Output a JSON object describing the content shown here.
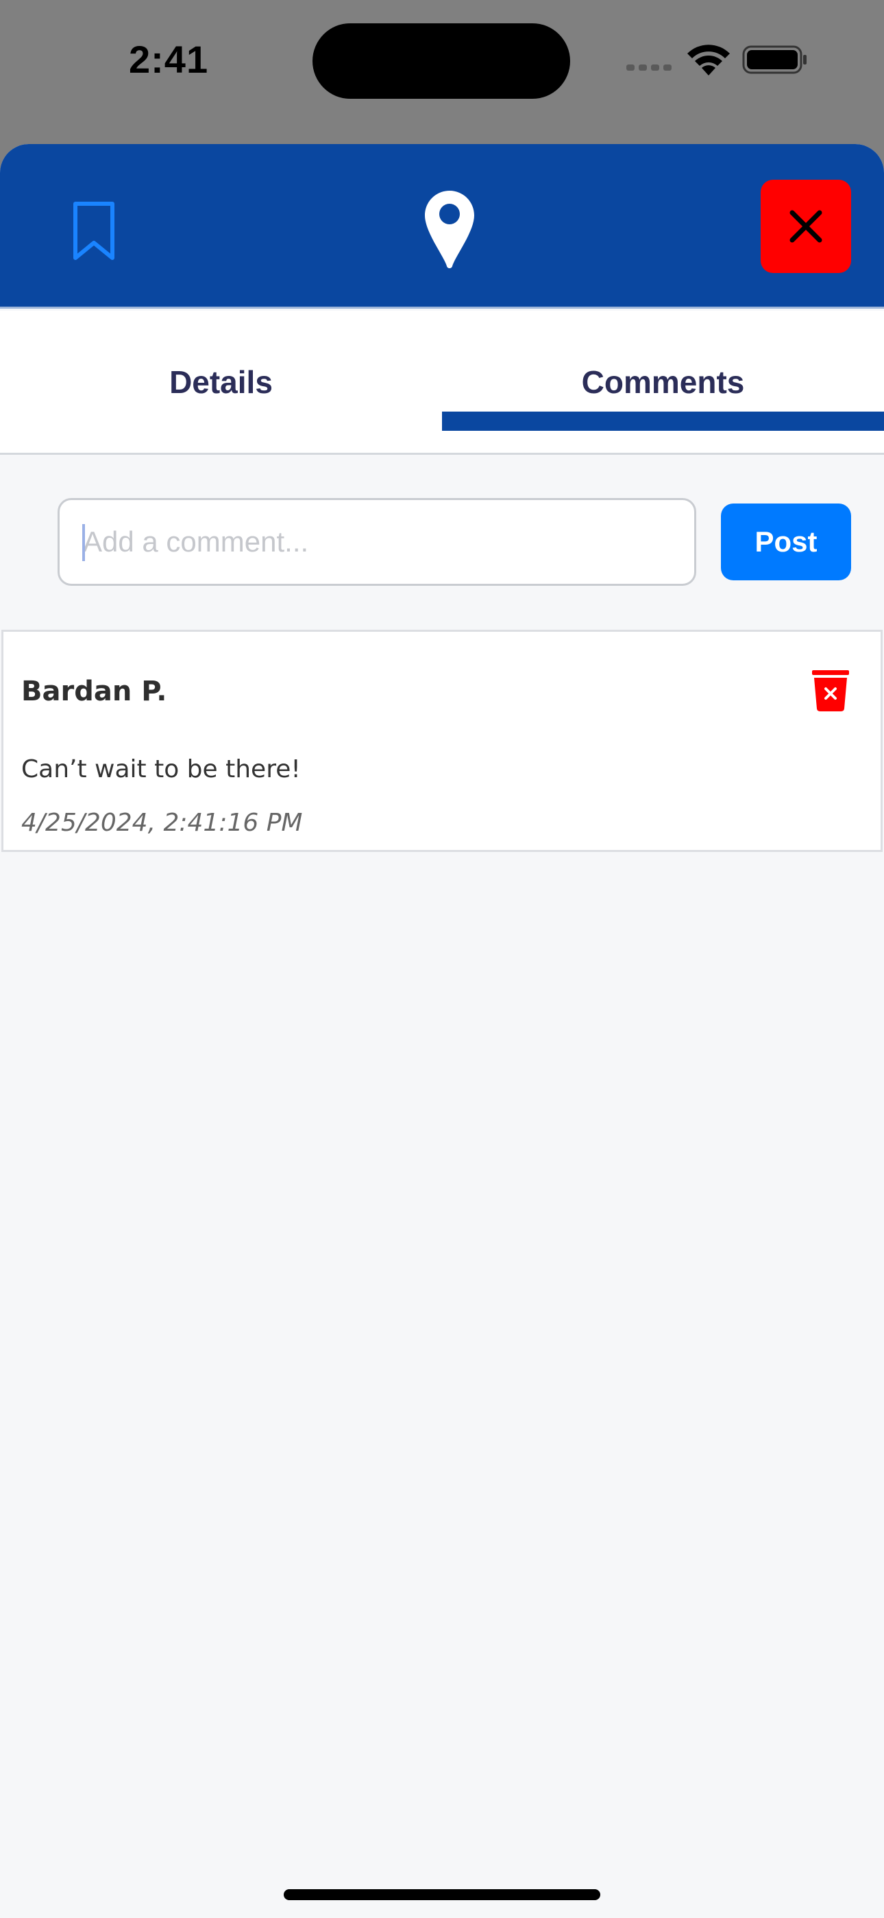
{
  "status_bar": {
    "time": "2:41"
  },
  "header": {
    "bookmark_icon": "bookmark-outline-icon",
    "pin_icon": "map-pin-icon",
    "close_icon": "close-x-icon"
  },
  "tabs": [
    {
      "label": "Details",
      "selected": false
    },
    {
      "label": "Comments",
      "selected": true
    }
  ],
  "comment_form": {
    "placeholder": "Add a comment...",
    "value": "",
    "post_label": "Post"
  },
  "comments": [
    {
      "author": "Bardan P.",
      "text": "Can’t wait to be there!",
      "timestamp": "4/25/2024, 2:41:16 PM",
      "delete_icon": "trash-icon"
    }
  ],
  "colors": {
    "header_bg": "#0a47a0",
    "accent": "#007aff",
    "close_bg": "#ff0000",
    "delete": "#ff0000",
    "tab_text": "#2b2d58"
  }
}
